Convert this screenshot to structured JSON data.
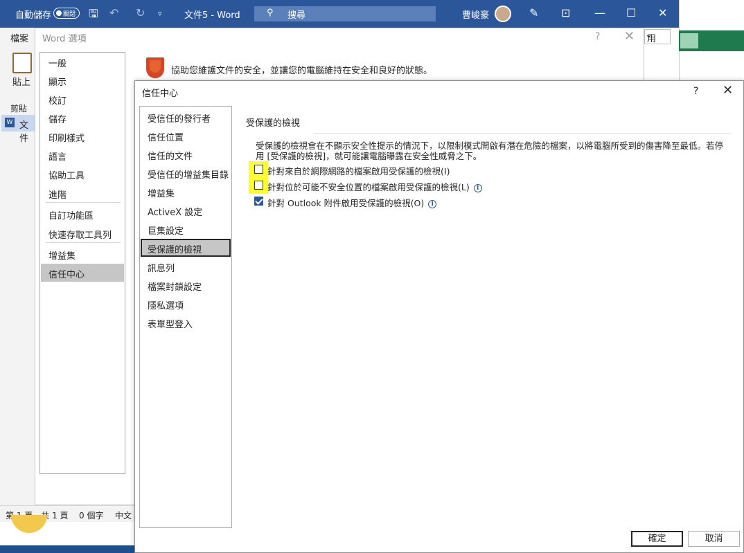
{
  "app": {
    "autosave_label": "自動儲存",
    "autosave_state": "關閉",
    "doc_title": "文件5 - Word",
    "search_placeholder": "搜尋",
    "user_name": "曹峻豪",
    "title_bar_color": "#2b579a"
  },
  "word_bg": {
    "file_tab": "檔案",
    "paste_label": "貼上",
    "clipboard_label": "剪貼簿",
    "doc_item": "文件",
    "status_page": "第 1 頁，共 1 頁",
    "status_words": "0 個字",
    "status_lang": "中文",
    "right_partial": "用"
  },
  "word_options": {
    "title": "Word 選項",
    "help": "?",
    "close": "✕",
    "header": "協助您維護文件的安全，並讓您的電腦維持在安全和良好的狀態。",
    "nav": [
      {
        "label": "一般"
      },
      {
        "label": "顯示"
      },
      {
        "label": "校訂"
      },
      {
        "label": "儲存"
      },
      {
        "label": "印刷樣式"
      },
      {
        "label": "語言"
      },
      {
        "label": "協助工具"
      },
      {
        "label": "進階"
      },
      {
        "label": "自訂功能區"
      },
      {
        "label": "快速存取工具列"
      },
      {
        "label": "增益集"
      },
      {
        "label": "信任中心"
      }
    ],
    "active": "信任中心"
  },
  "trust_center": {
    "title": "信任中心",
    "help": "?",
    "close": "✕",
    "nav": [
      {
        "label": "受信任的發行者"
      },
      {
        "label": "信任位置"
      },
      {
        "label": "信任的文件"
      },
      {
        "label": "受信任的增益集目錄"
      },
      {
        "label": "增益集"
      },
      {
        "label": "ActiveX 設定"
      },
      {
        "label": "巨集設定"
      },
      {
        "label": "受保護的檢視"
      },
      {
        "label": "訊息列"
      },
      {
        "label": "檔案封鎖設定"
      },
      {
        "label": "隱私選項"
      },
      {
        "label": "表單型登入"
      }
    ],
    "active": "受保護的檢視",
    "section_title": "受保護的檢視",
    "description": "受保護的檢視會在不顯示安全性提示的情況下，以限制模式開啟有潛在危險的檔案，以將電腦所受到的傷害降至最低。若停用 [受保護的檢視]，就可能讓電腦曝露在安全性威脅之下。",
    "options": [
      {
        "label": "針對來自於網際網路的檔案啟用受保護的檢視(I)",
        "checked": false,
        "highlighted": true,
        "info": false
      },
      {
        "label": "針對位於可能不安全位置的檔案啟用受保護的檢視(L)",
        "checked": false,
        "highlighted": true,
        "info": true
      },
      {
        "label": "針對 Outlook 附件啟用受保護的檢視(O)",
        "checked": true,
        "highlighted": false,
        "info": true
      }
    ],
    "ok_label": "確定",
    "cancel_label": "取消",
    "highlight_color": "#ffff33"
  }
}
